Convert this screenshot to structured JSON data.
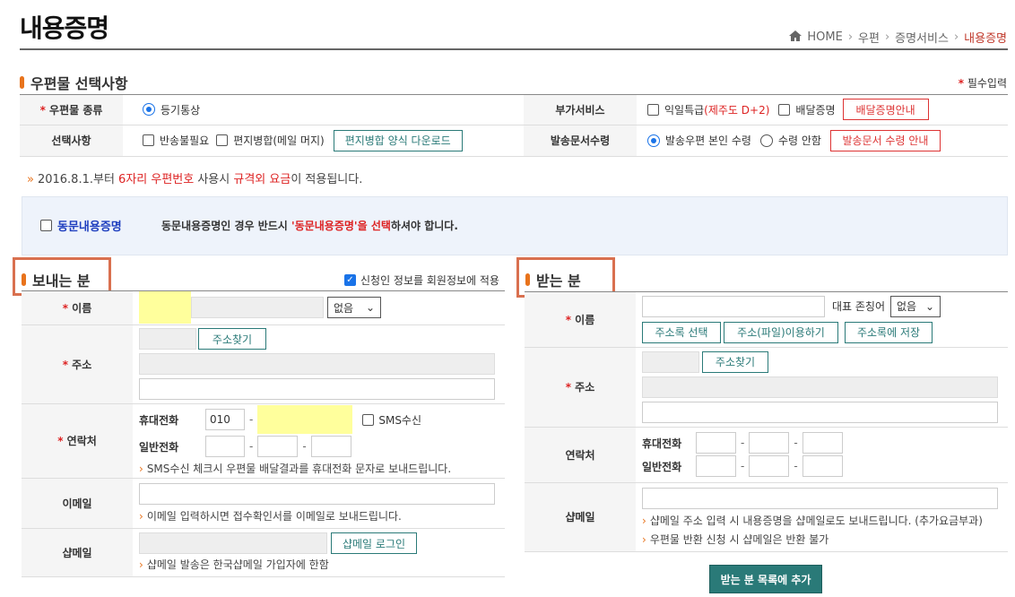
{
  "page": {
    "title": "내용증명"
  },
  "breadcrumb": {
    "home": "HOME",
    "items": [
      "우편",
      "증명서비스"
    ],
    "current": "내용증명"
  },
  "section1": {
    "title": "우편물 선택사항",
    "required_note": "필수입력",
    "required_mark": "*",
    "rows": {
      "mail_type": {
        "label": "우편물 종류",
        "option": "등기통상"
      },
      "extra_service": {
        "label": "부가서비스",
        "opt1": "익일특급",
        "opt1_note": "(제주도 D+2)",
        "opt2": "배달증명",
        "btn": "배달증명안내"
      },
      "options": {
        "label": "선택사항",
        "opt1": "반송불필요",
        "opt2": "편지병합(메일 머지)",
        "btn": "편지병합 양식 다운로드"
      },
      "doc_receive": {
        "label": "발송문서수령",
        "opt1": "발송우편 본인 수령",
        "opt2": "수령 안함",
        "btn": "발송문서 수령 안내"
      }
    }
  },
  "notice": {
    "prefix": "2016.8.1.부터 ",
    "highlight1": "6자리 우편번호",
    "mid": " 사용시 ",
    "highlight2": "규격외 요금",
    "suffix": "이 적용됩니다."
  },
  "joint": {
    "checkbox_label": "동문내용증명",
    "msg_prefix": "동문내용증명인 경우 반드시 ",
    "msg_highlight": "'동문내용증명'을 선택",
    "msg_suffix": "하셔야 합니다."
  },
  "sender": {
    "title": "보내는 분",
    "same_as_member": "신청인 정보를 회원정보에 적용",
    "name_label": "이름",
    "honorific": "없음",
    "address_label": "주소",
    "find_address": "주소찾기",
    "contact_label": "연락처",
    "mobile_label": "휴대전화",
    "mobile_prefix": "010",
    "sms_label": "SMS수신",
    "phone_label": "일반전화",
    "sms_note": "SMS수신 체크시 우편물 배달결과를 휴대전화 문자로 보내드립니다.",
    "email_label": "이메일",
    "email_note": "이메일 입력하시면 접수확인서를 이메일로 보내드립니다.",
    "shopmail_label": "샵메일",
    "shopmail_login": "샵메일 로그인",
    "shopmail_note": "샵메일 발송은 한국샵메일 가입자에 한함"
  },
  "receiver": {
    "title": "받는 분",
    "name_label": "이름",
    "honorific_label": "대표 존칭어",
    "honorific": "없음",
    "btn_addrbook": "주소록 선택",
    "btn_file": "주소(파일)이용하기",
    "btn_save": "주소록에 저장",
    "address_label": "주소",
    "find_address": "주소찾기",
    "contact_label": "연락처",
    "mobile_label": "휴대전화",
    "phone_label": "일반전화",
    "shopmail_label": "샵메일",
    "shopmail_note1": "샵메일 주소 입력 시 내용증명을 샵메일로도 보내드립니다. (추가요금부과)",
    "shopmail_note2": "우편물 반환 신청 시 샵메일은 반환 불가",
    "add_button": "받는 분 목록에 추가"
  },
  "colors": {
    "accent": "#e8731c",
    "teal": "#2a7a78",
    "red": "#d33",
    "highlight_box": "#d9704f"
  }
}
